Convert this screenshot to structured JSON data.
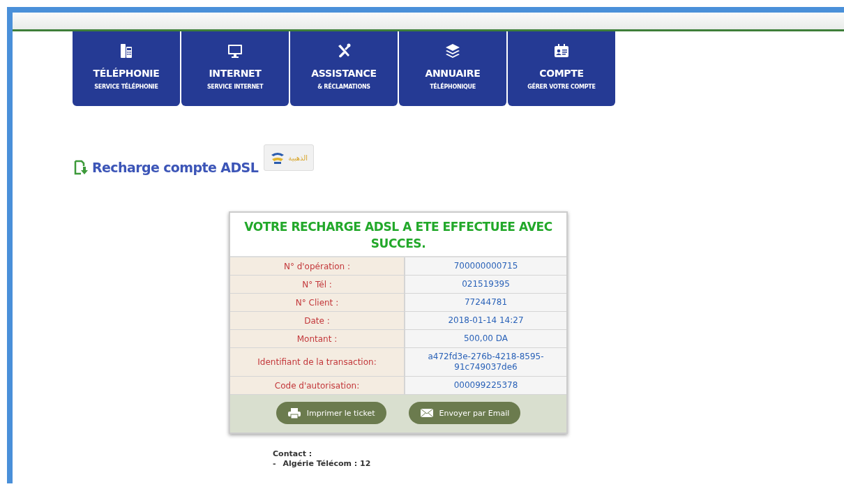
{
  "nav": [
    {
      "title": "TÉLÉPHONIE",
      "subtitle": "SERVICE TÉLÉPHONIE"
    },
    {
      "title": "INTERNET",
      "subtitle": "SERVICE INTERNET"
    },
    {
      "title": "ASSISTANCE",
      "subtitle": "& RÉCLAMATIONS"
    },
    {
      "title": "ANNUAIRE",
      "subtitle": "TÉLÉPHONIQUE"
    },
    {
      "title": "COMPTE",
      "subtitle": "GÉRER VOTRE COMPTE"
    }
  ],
  "heading": "Recharge compte ADSL",
  "logo_text": "الذهبية",
  "receipt": {
    "title": "VOTRE RECHARGE ADSL A ETE EFFECTUEE AVEC SUCCES.",
    "rows": [
      {
        "label": "N° d'opération :",
        "value": "700000000715"
      },
      {
        "label": "N° Tél :",
        "value": "021519395"
      },
      {
        "label": "N° Client :",
        "value": "77244781"
      },
      {
        "label": "Date :",
        "value": "2018-01-14 14:27"
      },
      {
        "label": "Montant :",
        "value": "500,00 DA"
      },
      {
        "label": "Identifiant de la transaction:",
        "value": "a472fd3e-276b-4218-8595-91c749037de6"
      },
      {
        "label": "Code d'autorisation:",
        "value": "000099225378"
      }
    ],
    "buttons": [
      {
        "label": "Imprimer le ticket"
      },
      {
        "label": "Envoyer par Email"
      }
    ]
  },
  "contact": {
    "title": "Contact :",
    "items": [
      {
        "bullet": "-",
        "text": "Algérie Télécom : 12"
      }
    ]
  }
}
